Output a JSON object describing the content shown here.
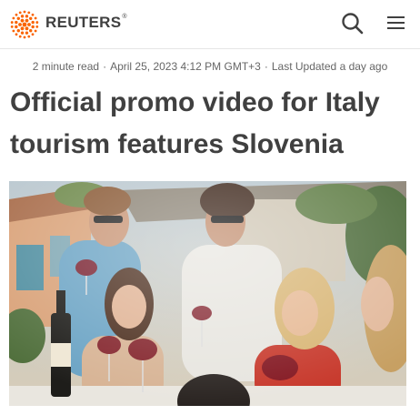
{
  "header": {
    "logo_text": "REUTERS",
    "logo_registered": "®",
    "brand_color": "#fa6400",
    "icons": [
      "reuters-dot-logo-icon",
      "search-icon",
      "hamburger-menu-icon"
    ]
  },
  "byline": {
    "read_time": "2 minute read",
    "separator": "·",
    "published": "April 25, 2023 4:12 PM GMT+3",
    "updated": "Last Updated a day ago"
  },
  "article": {
    "headline": "Official promo video for Italy tourism features Slovenia"
  },
  "colors": {
    "text": "#404040",
    "meta_text": "#666666",
    "divider": "#e6e6e6"
  }
}
